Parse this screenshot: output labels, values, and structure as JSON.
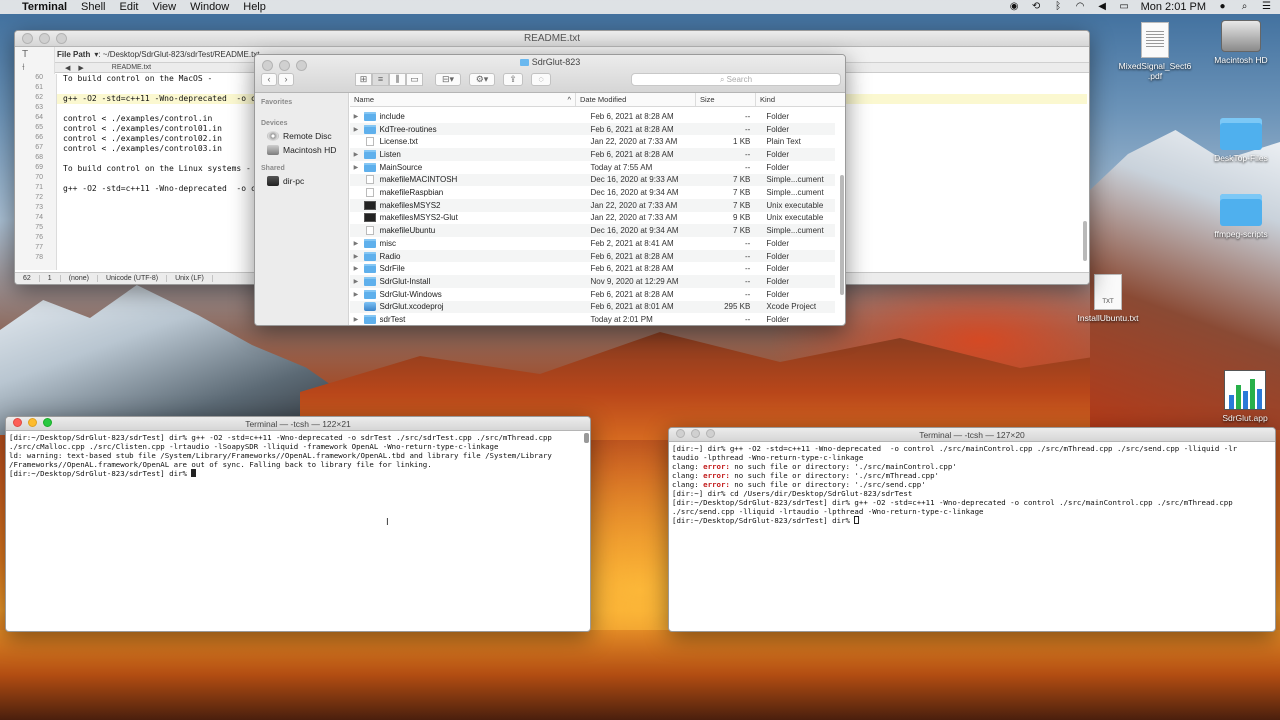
{
  "menubar": {
    "app": "Terminal",
    "items": [
      "Shell",
      "Edit",
      "View",
      "Window",
      "Help"
    ],
    "clock": "Mon 2:01 PM"
  },
  "editor": {
    "title": "README.txt",
    "path_label": "File Path",
    "path": ": ~/Desktop/SdrGlut-823/sdrTest/README.txt",
    "tab": "README.txt",
    "lines": [
      {
        "n": "60",
        "text": "To build control on the MacOS -"
      },
      {
        "n": "61",
        "text": ""
      },
      {
        "n": "62",
        "text": "g++ -O2 -std=c++11 -Wno-deprecated  -o c"
      },
      {
        "n": "63",
        "text": ""
      },
      {
        "n": "64",
        "text": "control < ./examples/control.in"
      },
      {
        "n": "65",
        "text": "control < ./examples/control01.in"
      },
      {
        "n": "66",
        "text": "control < ./examples/control02.in"
      },
      {
        "n": "67",
        "text": "control < ./examples/control03.in"
      },
      {
        "n": "68",
        "text": ""
      },
      {
        "n": "69",
        "text": "To build control on the Linux systems -"
      },
      {
        "n": "70",
        "text": ""
      },
      {
        "n": "71",
        "text": "g++ -O2 -std=c++11 -Wno-deprecated  -o c"
      },
      {
        "n": "72",
        "text": ""
      },
      {
        "n": "73",
        "text": ""
      },
      {
        "n": "74",
        "text": ""
      },
      {
        "n": "75",
        "text": ""
      },
      {
        "n": "76",
        "text": ""
      },
      {
        "n": "77",
        "text": ""
      },
      {
        "n": "78",
        "text": ""
      }
    ],
    "status": {
      "line": "62",
      "col": "1",
      "language": "(none)",
      "encoding": "Unicode (UTF-8)",
      "line_endings": "Unix (LF)"
    }
  },
  "finder": {
    "title": "SdrGlut-823",
    "search_placeholder": "Search",
    "sidebar": {
      "favorites_label": "Favorites",
      "devices_label": "Devices",
      "devices": [
        "Remote Disc",
        "Macintosh HD"
      ],
      "shared_label": "Shared",
      "shared": [
        "dir-pc"
      ]
    },
    "columns": {
      "name": "Name",
      "date": "Date Modified",
      "size": "Size",
      "kind": "Kind"
    },
    "rows": [
      {
        "name": "include",
        "date": "Feb 6, 2021 at 8:28 AM",
        "size": "--",
        "kind": "Folder",
        "type": "folder"
      },
      {
        "name": "KdTree-routines",
        "date": "Feb 6, 2021 at 8:28 AM",
        "size": "--",
        "kind": "Folder",
        "type": "folder"
      },
      {
        "name": "License.txt",
        "date": "Jan 22, 2020 at 7:33 AM",
        "size": "1 KB",
        "kind": "Plain Text",
        "type": "doc"
      },
      {
        "name": "Listen",
        "date": "Feb 6, 2021 at 8:28 AM",
        "size": "--",
        "kind": "Folder",
        "type": "folder"
      },
      {
        "name": "MainSource",
        "date": "Today at 7:55 AM",
        "size": "--",
        "kind": "Folder",
        "type": "folder"
      },
      {
        "name": "makefileMACINTOSH",
        "date": "Dec 16, 2020 at 9:33 AM",
        "size": "7 KB",
        "kind": "Simple...cument",
        "type": "doc"
      },
      {
        "name": "makefileRaspbian",
        "date": "Dec 16, 2020 at 9:34 AM",
        "size": "7 KB",
        "kind": "Simple...cument",
        "type": "doc"
      },
      {
        "name": "makefilesMSYS2",
        "date": "Jan 22, 2020 at 7:33 AM",
        "size": "7 KB",
        "kind": "Unix executable",
        "type": "exe"
      },
      {
        "name": "makefilesMSYS2-Glut",
        "date": "Jan 22, 2020 at 7:33 AM",
        "size": "9 KB",
        "kind": "Unix executable",
        "type": "exe"
      },
      {
        "name": "makefileUbuntu",
        "date": "Dec 16, 2020 at 9:34 AM",
        "size": "7 KB",
        "kind": "Simple...cument",
        "type": "doc"
      },
      {
        "name": "misc",
        "date": "Feb 2, 2021 at 8:41 AM",
        "size": "--",
        "kind": "Folder",
        "type": "folder"
      },
      {
        "name": "Radio",
        "date": "Feb 6, 2021 at 8:28 AM",
        "size": "--",
        "kind": "Folder",
        "type": "folder"
      },
      {
        "name": "SdrFile",
        "date": "Feb 6, 2021 at 8:28 AM",
        "size": "--",
        "kind": "Folder",
        "type": "folder"
      },
      {
        "name": "SdrGlut-Install",
        "date": "Nov 9, 2020 at 12:29 AM",
        "size": "--",
        "kind": "Folder",
        "type": "folder"
      },
      {
        "name": "SdrGlut-Windows",
        "date": "Feb 6, 2021 at 8:28 AM",
        "size": "--",
        "kind": "Folder",
        "type": "folder"
      },
      {
        "name": "SdrGlut.xcodeproj",
        "date": "Feb 6, 2021 at 8:01 AM",
        "size": "295 KB",
        "kind": "Xcode Project",
        "type": "xcode"
      },
      {
        "name": "sdrTest",
        "date": "Today at 2:01 PM",
        "size": "--",
        "kind": "Folder",
        "type": "folder"
      }
    ]
  },
  "term1": {
    "title": "Terminal — -tcsh — 122×21",
    "lines": [
      "[dir:~/Desktop/SdrGlut-823/sdrTest] dir% g++ -O2 -std=c++11 -Wno-deprecated -o sdrTest ./src/sdrTest.cpp ./src/mThread.cpp",
      "./src/cMalloc.cpp ./src/Clisten.cpp -lrtaudio -lSoapySDR -lliquid -framework OpenAL -Wno-return-type-c-linkage",
      "ld: warning: text-based stub file /System/Library/Frameworks//OpenAL.framework/OpenAL.tbd and library file /System/Library",
      "/Frameworks//OpenAL.framework/OpenAL are out of sync. Falling back to library file for linking.",
      "[dir:~/Desktop/SdrGlut-823/sdrTest] dir% "
    ]
  },
  "term2": {
    "title": "Terminal — -tcsh — 127×20",
    "lines": [
      "[dir:~] dir% g++ -O2 -std=c++11 -Wno-deprecated  -o control ./src/mainControl.cpp ./src/mThread.cpp ./src/send.cpp -lliquid -lr",
      "taudio -lpthread -Wno-return-type-c-linkage",
      "clang: ",
      "clang: ",
      "clang: ",
      "[dir:~] dir% cd /Users/dir/Desktop/SdrGlut-823/sdrTest",
      "[dir:~/Desktop/SdrGlut-823/sdrTest] dir% g++ -O2 -std=c++11 -Wno-deprecated -o control ./src/mainControl.cpp ./src/mThread.cpp",
      "./src/send.cpp -lliquid -lrtaudio -lpthread -Wno-return-type-c-linkage",
      "[dir:~/Desktop/SdrGlut-823/sdrTest] dir% "
    ],
    "error_word": "error:",
    "error_tails": [
      " no such file or directory: './src/mainControl.cpp'",
      " no such file or directory: './src/mThread.cpp'",
      " no such file or directory: './src/send.cpp'"
    ]
  },
  "desktop": {
    "icons": [
      {
        "label": "MixedSignal_Sect6\n.pdf"
      },
      {
        "label": "Macintosh HD"
      },
      {
        "label": "DeskTop-Files"
      },
      {
        "label": "ffmpeg-scripts"
      },
      {
        "label": "InstallUbuntu.txt"
      },
      {
        "label": "SdrGlut.app"
      }
    ],
    "txt_badge": "TXT"
  }
}
